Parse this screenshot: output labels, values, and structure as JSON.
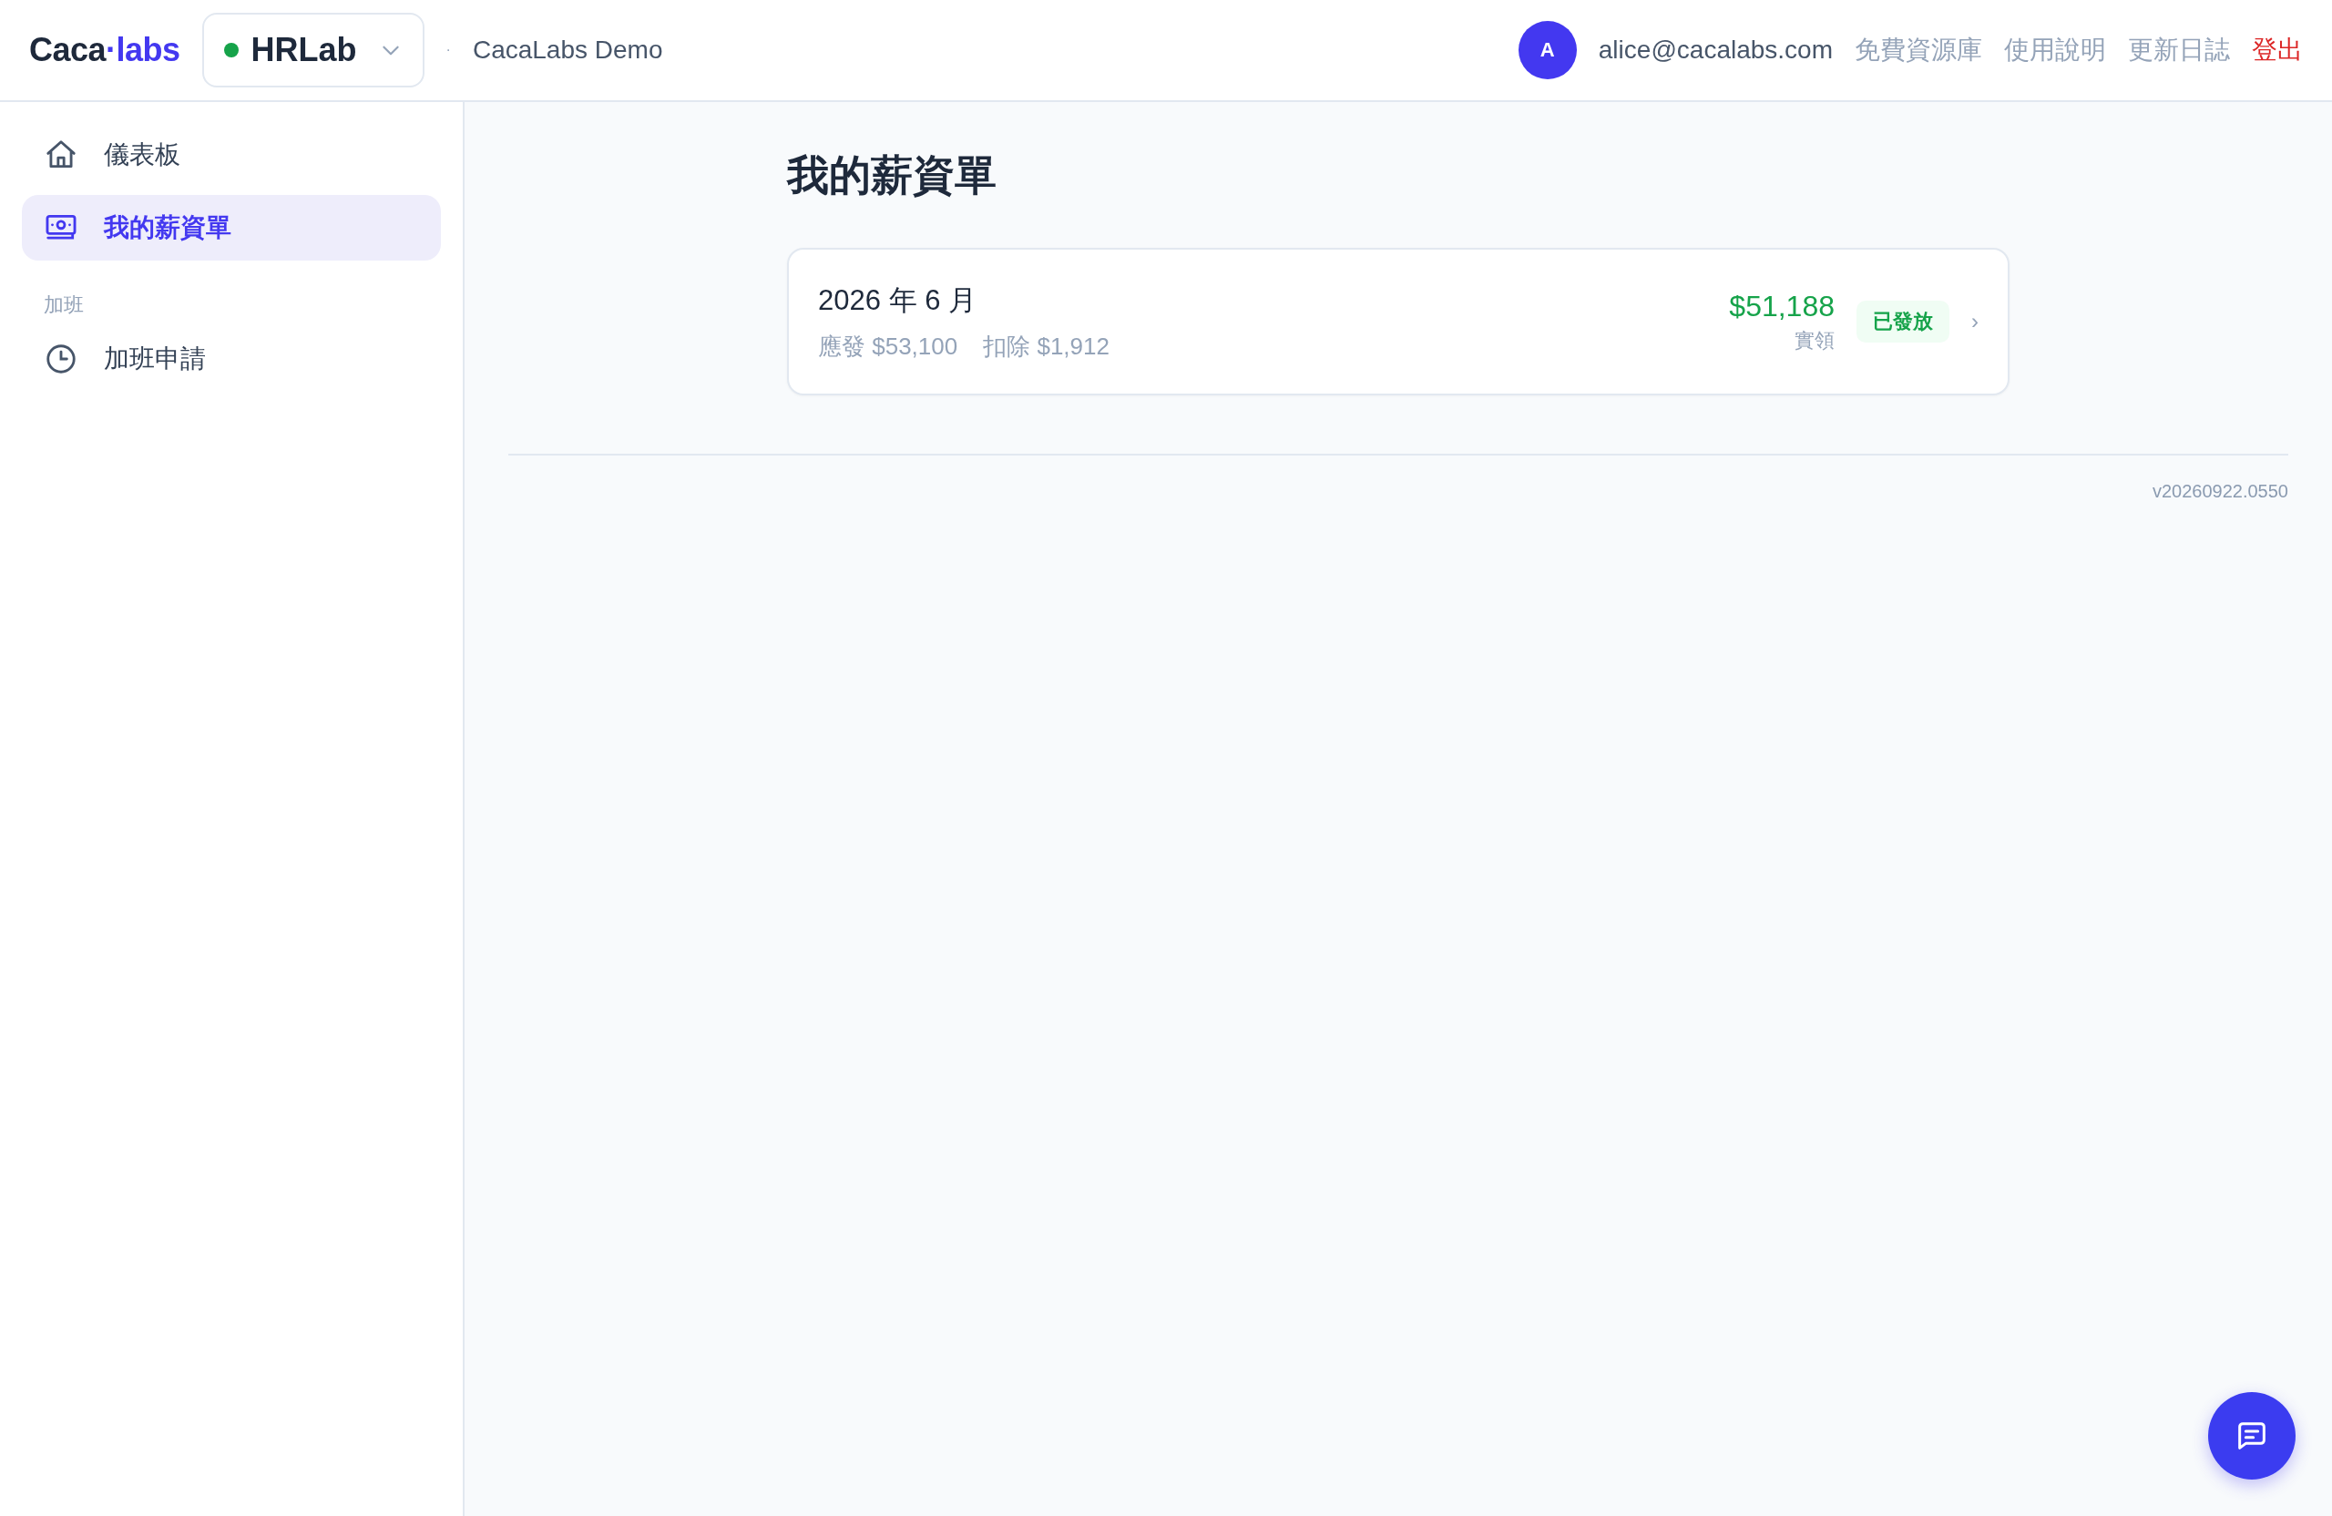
{
  "header": {
    "logo": [
      {
        "text": "Caca",
        "kind": "plain"
      },
      {
        "text": "·labs",
        "kind": "accent"
      }
    ],
    "workspace": {
      "name": "HRLab",
      "color": "#16a34a"
    },
    "separator": "·",
    "organization": "CacaLabs Demo",
    "avatar": "A",
    "email": "alice@cacalabs.com",
    "links": [
      {
        "label": "免費資源庫",
        "kind": "muted"
      },
      {
        "label": "使用說明",
        "kind": "muted"
      },
      {
        "label": "更新日誌",
        "kind": "muted"
      },
      {
        "label": "登出",
        "kind": "danger"
      }
    ]
  },
  "sidebar": {
    "items": [
      {
        "kind": "link",
        "label": "儀表板",
        "selected": false
      },
      {
        "kind": "link",
        "label": "我的薪資單",
        "selected": true
      },
      {
        "kind": "section",
        "label": "加班"
      },
      {
        "kind": "link",
        "label": "加班申請",
        "selected": false
      }
    ]
  },
  "page": {
    "title": "我的薪資單",
    "payslips": [
      {
        "period": "2026 年 6 月",
        "gross": "應發 $53,100",
        "deduction": "扣除 $1,912",
        "net": "$51,188",
        "net_label": "實領",
        "status": "已發放",
        "chevron": "›"
      }
    ],
    "version": "v20260922.0550"
  }
}
